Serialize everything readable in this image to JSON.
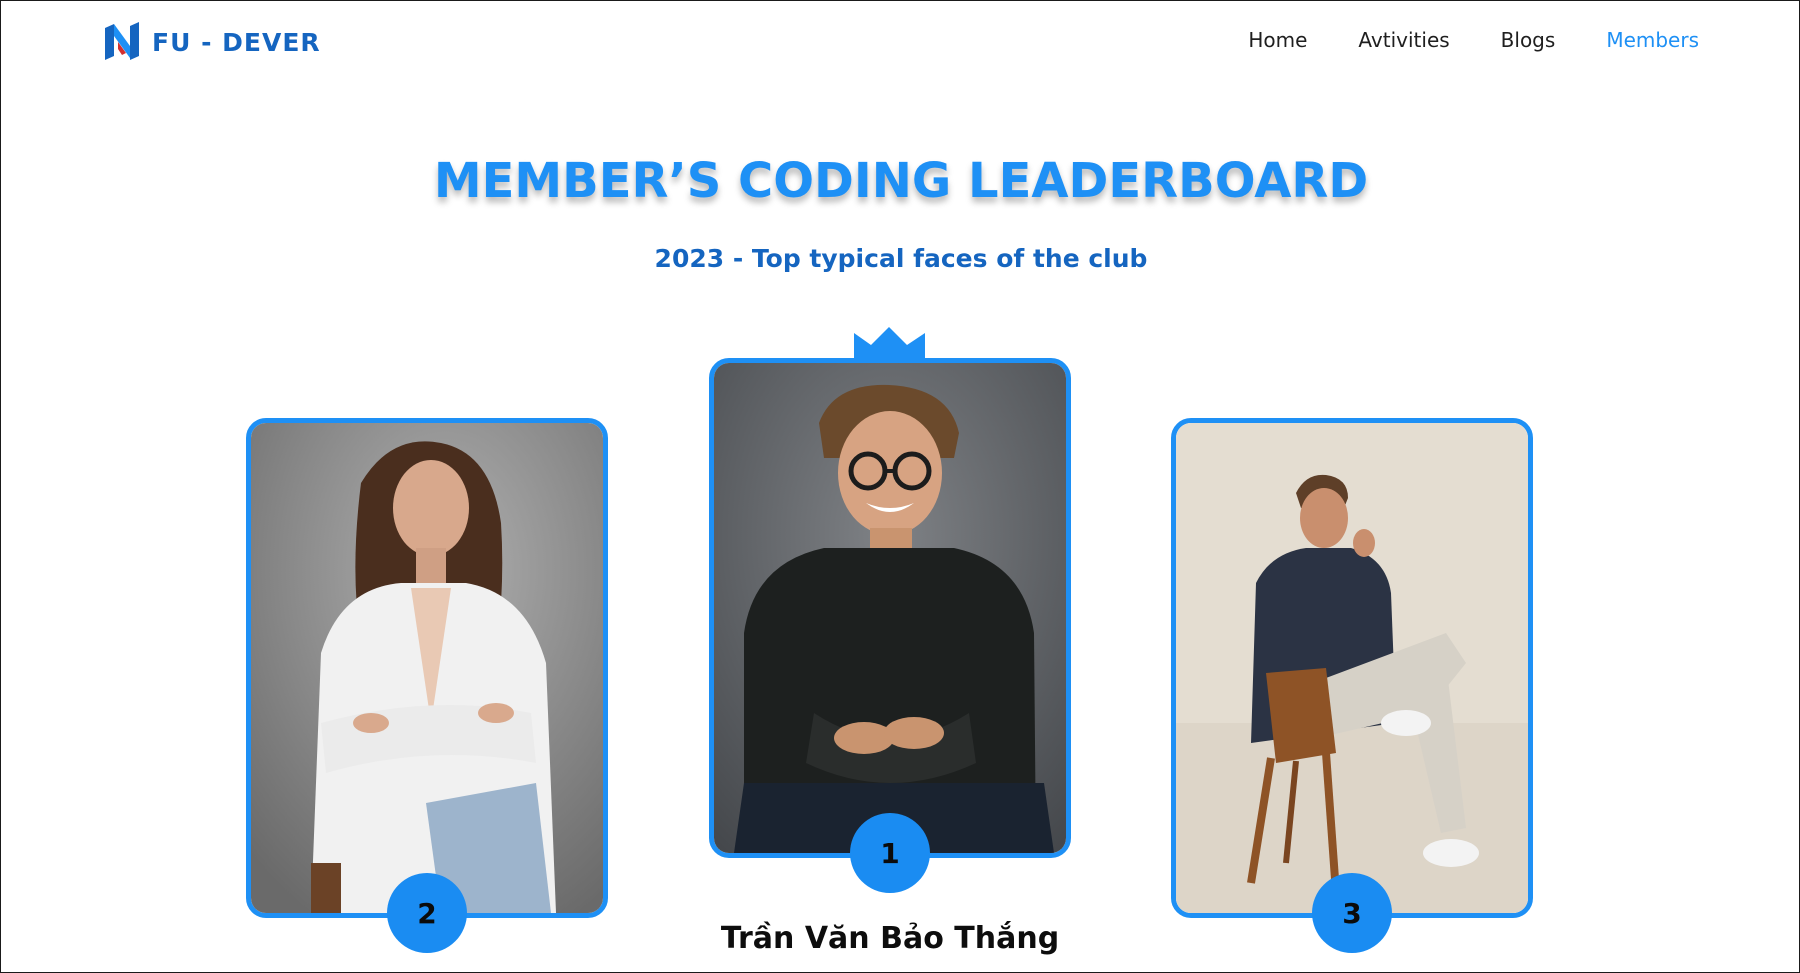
{
  "header": {
    "logo_text": "FU - DEVER",
    "nav": [
      {
        "label": "Home",
        "active": false
      },
      {
        "label": "Avtivities",
        "active": false
      },
      {
        "label": "Blogs",
        "active": false
      },
      {
        "label": "Members",
        "active": true
      }
    ]
  },
  "page": {
    "title": "MEMBER’S CODING LEADERBOARD",
    "subtitle": "2023 - Top typical faces of the club"
  },
  "leaderboard": {
    "first": {
      "rank": "1",
      "name": "Trần Văn Bảo Thắng"
    },
    "second": {
      "rank": "2"
    },
    "third": {
      "rank": "3"
    }
  },
  "colors": {
    "accent": "#1e90f5",
    "brand_dark": "#1565c0",
    "nav_text": "#1f1f1f",
    "name_text": "#0d0d0d"
  },
  "icons": {
    "logo": "fu-dever-logo-icon",
    "crown": "crown-icon"
  }
}
